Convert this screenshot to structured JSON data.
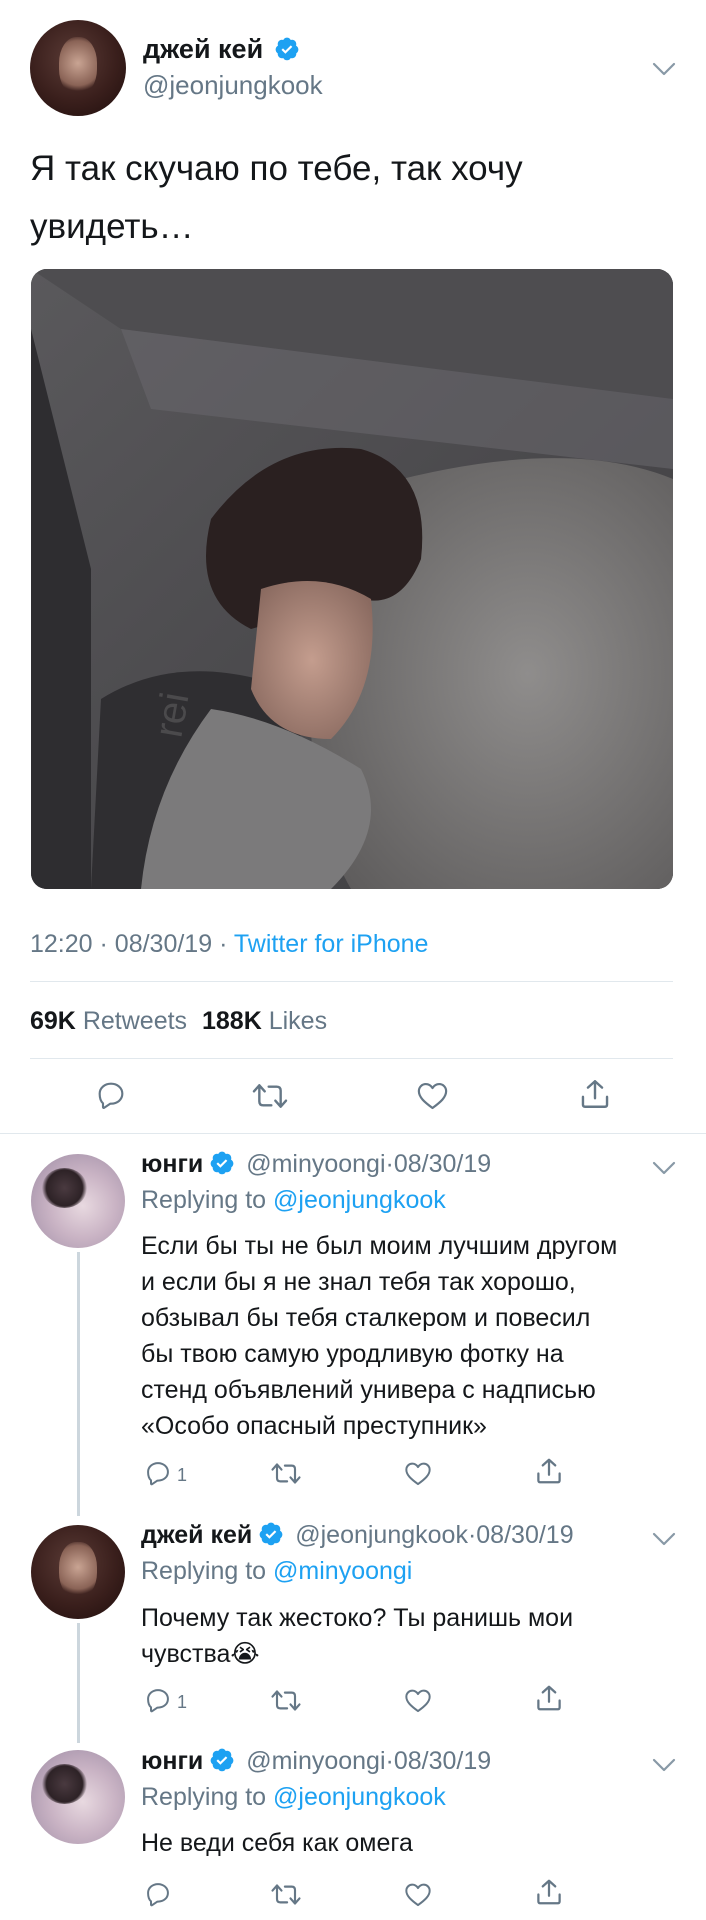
{
  "main_tweet": {
    "display_name": "джей кей",
    "handle": "@jeonjungkook",
    "text_line1": "Я так скучаю по тебе, так хочу",
    "text_line2": "увидеть…",
    "time": "12:20",
    "date": "08/30/19",
    "source": "Twitter for iPhone",
    "retweets_count": "69K",
    "retweets_label": "Retweets",
    "likes_count": "188K",
    "likes_label": "Likes",
    "photo_overlay_text": "rei"
  },
  "replies": [
    {
      "display_name": "юнги",
      "handle": "@minyoongi",
      "date": "08/30/19",
      "replying_prefix": "Replying to",
      "replying_to": "@jeonjungkook",
      "lines": [
        "Если бы ты не был моим лучшим другом",
        "и если бы я не знал тебя так хорошо,",
        "обзывал бы тебя сталкером и повесил",
        "бы твою самую уродливую фотку на",
        "стенд объявлений универа с надписью",
        "«Особо опасный преступник»"
      ],
      "reply_count": "1"
    },
    {
      "display_name": "джей кей",
      "handle": "@jeonjungkook",
      "date": "08/30/19",
      "replying_prefix": "Replying to",
      "replying_to": "@minyoongi",
      "lines": [
        "Почему так жестоко? Ты ранишь мои",
        "чувства"
      ],
      "emoji": "😭",
      "reply_count": "1"
    },
    {
      "display_name": "юнги",
      "handle": "@minyoongi",
      "date": "08/30/19",
      "replying_prefix": "Replying to",
      "replying_to": "@jeonjungkook",
      "lines": [
        "Не веди себя как омега"
      ],
      "reply_count": ""
    }
  ],
  "separator": "·",
  "colors": {
    "link": "#1da1f2",
    "muted": "#657786",
    "text": "#14171a",
    "divider": "#e1e8ed"
  },
  "icons": [
    "verified-badge-icon",
    "chevron-down-icon",
    "reply-icon",
    "retweet-icon",
    "like-icon",
    "share-icon"
  ]
}
